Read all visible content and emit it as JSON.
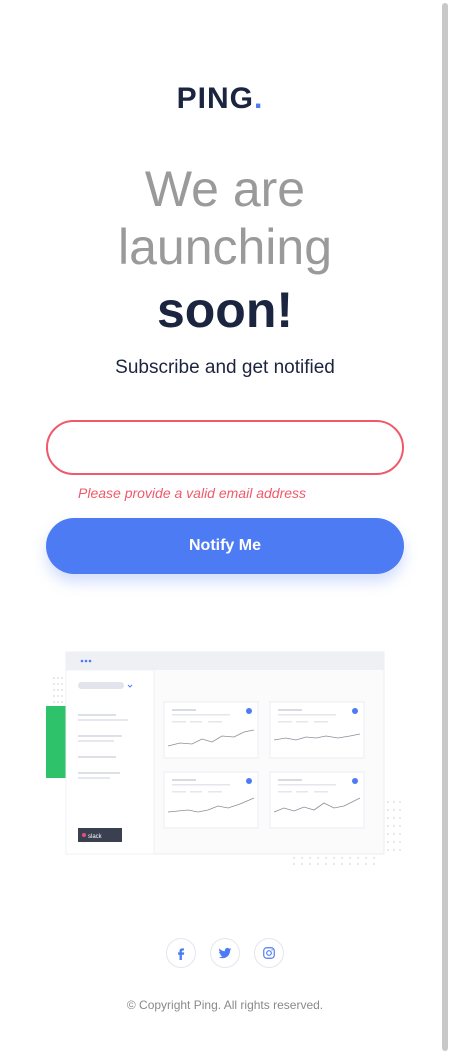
{
  "logo": {
    "text": "PING",
    "dot": "."
  },
  "headline": {
    "line1": "We are",
    "line2": "launching",
    "line3": "soon!"
  },
  "subtitle": "Subscribe and get notified",
  "form": {
    "email_value": "",
    "error": "Please provide a valid email address",
    "button_label": "Notify Me"
  },
  "illustration": {
    "badge": "slack"
  },
  "social": [
    {
      "name": "facebook-icon"
    },
    {
      "name": "twitter-icon"
    },
    {
      "name": "instagram-icon"
    }
  ],
  "footer": {
    "copyright": "© Copyright Ping. All rights reserved."
  },
  "colors": {
    "brand_blue": "#4c7bf3",
    "dark_navy": "#1b2540",
    "error_red": "#f0596a",
    "gray_text": "#9a9a9a"
  }
}
